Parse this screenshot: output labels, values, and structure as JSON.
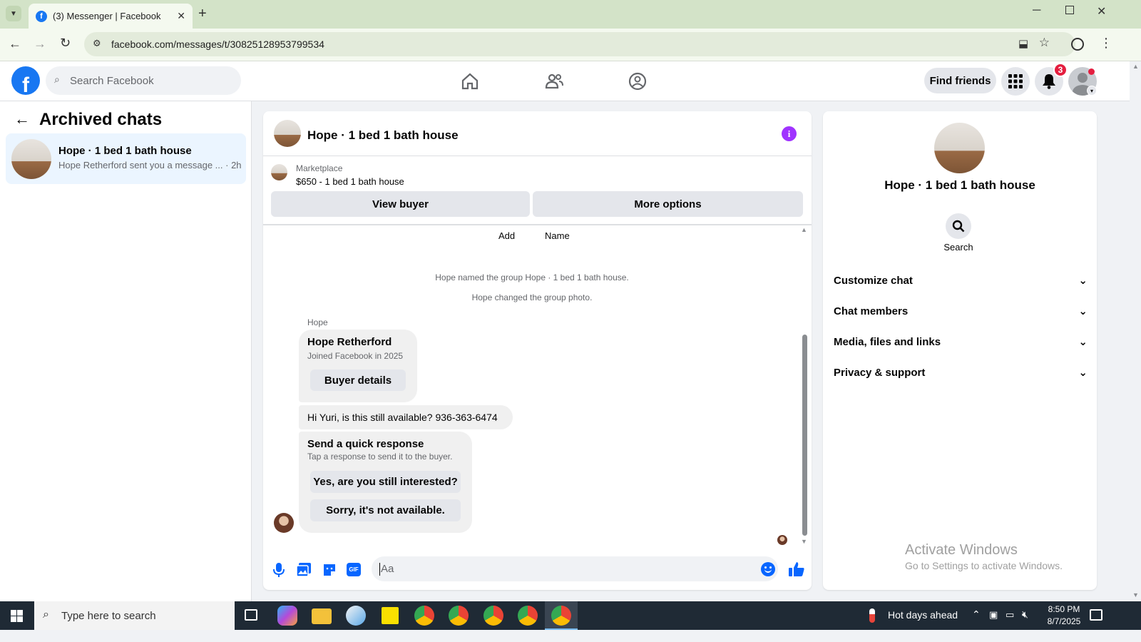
{
  "browser": {
    "tab_title": "(3) Messenger | Facebook",
    "url": "facebook.com/messages/t/30825128953799534"
  },
  "fbnav": {
    "search_placeholder": "Search Facebook",
    "find_friends": "Find friends",
    "notification_count": "3"
  },
  "left": {
    "title": "Archived chats",
    "chat": {
      "name": "Hope · 1 bed 1 bath house",
      "preview": "Hope Retherford sent you a message ...",
      "time": "· 2h"
    }
  },
  "conversation": {
    "title": "Hope · 1 bed 1 bath house",
    "marketplace_label": "Marketplace",
    "listing": "$650 - 1 bed 1 bath house",
    "view_buyer": "View buyer",
    "more_options": "More options",
    "action_add": "Add",
    "action_name": "Name",
    "system_msg_1": "Hope named the group Hope · 1 bed 1 bath house.",
    "system_msg_2": "Hope changed the group photo.",
    "sender_label": "Hope",
    "card_name": "Hope Retherford",
    "card_joined": "Joined Facebook in 2025",
    "buyer_details": "Buyer details",
    "message": "Hi Yuri, is this still available? 936-363-6474",
    "quick_title": "Send a quick response",
    "quick_sub": "Tap a response to send it to the buyer.",
    "quick_1": "Yes, are you still interested?",
    "quick_2": "Sorry, it's not available.",
    "composer_placeholder": "Aa"
  },
  "info_panel": {
    "name": "Hope · 1 bed 1 bath house",
    "search_label": "Search",
    "rows": [
      "Customize chat",
      "Chat members",
      "Media, files and links",
      "Privacy & support"
    ],
    "watermark_title": "Activate Windows",
    "watermark_sub": "Go to Settings to activate Windows."
  },
  "taskbar": {
    "search_placeholder": "Type here to search",
    "weather": "Hot days ahead",
    "time": "8:50 PM",
    "date": "8/7/2025"
  },
  "colors": {
    "fb_blue": "#1877f2",
    "messenger_purple": "#a033ff",
    "notify_red": "#e41e3f"
  }
}
